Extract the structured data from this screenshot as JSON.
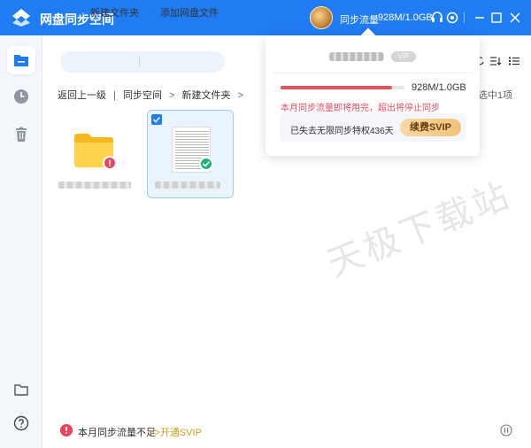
{
  "app": {
    "title": "网盘同步空间",
    "sync_label": "同步流量",
    "sync_value": "928M/1.0GB",
    "accent": "#1f7cf2"
  },
  "toolbar": {
    "new_folder": "新建文件夹",
    "add_drive_file": "添加网盘文件",
    "selected_count": "选中1项"
  },
  "breadcrumb": {
    "back": "返回上一级",
    "sep1": "|",
    "level1": "同步空间",
    "arrow1": ">",
    "level2": "新建文件夹",
    "arrow2": ">"
  },
  "popup": {
    "vip_tag": "VIP",
    "usage_value": "928M/1.0GB",
    "usage_fraction": 0.9,
    "warning": "本月同步流量即将用完，超出将停止同步",
    "promo": "已失去无限同步特权436天",
    "renew_button": "续费SVIP"
  },
  "files": [
    {
      "type": "folder",
      "status": "error",
      "selected": false
    },
    {
      "type": "document",
      "status": "synced",
      "selected": true
    }
  ],
  "watermark": "天极下载站",
  "status": {
    "message": "本月同步流量不足",
    "link": ">>开通SVIP"
  },
  "icons": {
    "sidebar": [
      "files-icon",
      "recent-icon",
      "trash-icon",
      "folder-icon",
      "help-icon"
    ],
    "titlebar": [
      "support-icon",
      "settings-icon",
      "minimize-icon",
      "maximize-icon",
      "close-icon"
    ]
  },
  "colors": {
    "error": "#e8455a",
    "success": "#1fb37a",
    "progress": "#e8525b",
    "link": "#c99b1b"
  }
}
